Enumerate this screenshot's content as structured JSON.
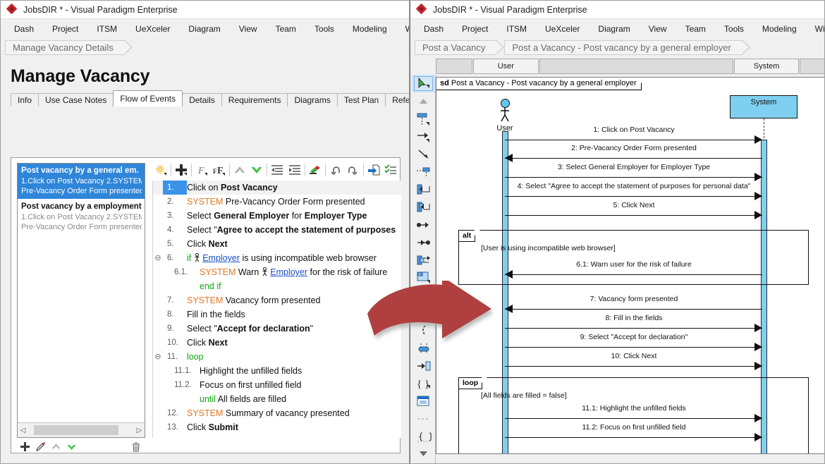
{
  "left_window": {
    "title": "JobsDIR * - Visual Paradigm Enterprise",
    "menu": [
      "Dash",
      "Project",
      "ITSM",
      "UeXceler",
      "Diagram",
      "View",
      "Team",
      "Tools",
      "Modeling",
      "Wi"
    ],
    "breadcrumb": [
      "Manage Vacancy Details"
    ],
    "page_title": "Manage Vacancy",
    "tabs": [
      {
        "label": "Info",
        "active": false
      },
      {
        "label": "Use Case Notes",
        "active": false
      },
      {
        "label": "Flow of Events",
        "active": true
      },
      {
        "label": "Details",
        "active": false
      },
      {
        "label": "Requirements",
        "active": false
      },
      {
        "label": "Diagrams",
        "active": false
      },
      {
        "label": "Test Plan",
        "active": false
      },
      {
        "label": "References",
        "active": false
      }
    ],
    "scenario_list": [
      {
        "title": "Post vacancy by a general em.",
        "sub1": "1.Click on Post Vacancy 2.SYSTEM",
        "sub2": "Pre-Vacancy Order Form presented...",
        "selected": true
      },
      {
        "title": "Post vacancy by a employment ager",
        "sub1": "1.Click on Post Vacancy 2.SYSTEM",
        "sub2": "Pre-Vacancy Order Form presented...",
        "selected": false
      }
    ],
    "list_toolbar_icons": [
      "add-icon",
      "pen-icon",
      "move-up-icon",
      "move-down-icon",
      "delete-icon"
    ],
    "editor_toolbar_icons": [
      "sparkle-icon",
      "add-icon",
      "italic-icon",
      "font-size-icon",
      "move-up-icon",
      "move-down-icon",
      "outdent-icon",
      "indent-icon",
      "highlight-icon",
      "undo-icon",
      "redo-icon",
      "insert-sub-icon",
      "checklist-icon"
    ],
    "flow_of_events": [
      {
        "num": "1.",
        "highlighted": true,
        "indent": 0,
        "parts": [
          {
            "t": "Click on ",
            "s": "n"
          },
          {
            "t": "Post Vacancy",
            "s": "b"
          }
        ]
      },
      {
        "num": "2.",
        "highlighted": false,
        "indent": 0,
        "parts": [
          {
            "t": "SYSTEM",
            "s": "sys"
          },
          {
            "t": "   Pre-Vacancy Order Form presented",
            "s": "n"
          }
        ]
      },
      {
        "num": "3.",
        "highlighted": false,
        "indent": 0,
        "parts": [
          {
            "t": "Select ",
            "s": "n"
          },
          {
            "t": "General Employer",
            "s": "b"
          },
          {
            "t": " for ",
            "s": "n"
          },
          {
            "t": "Employer Type",
            "s": "b"
          }
        ]
      },
      {
        "num": "4.",
        "highlighted": false,
        "indent": 0,
        "parts": [
          {
            "t": "Select \"",
            "s": "n"
          },
          {
            "t": "Agree to accept the statement of purposes",
            "s": "b"
          }
        ]
      },
      {
        "num": "5.",
        "highlighted": false,
        "indent": 0,
        "parts": [
          {
            "t": "Click ",
            "s": "n"
          },
          {
            "t": "Next",
            "s": "b"
          }
        ]
      },
      {
        "num": "6.",
        "highlighted": false,
        "indent": 0,
        "collapse": true,
        "parts": [
          {
            "t": "if",
            "s": "kw"
          },
          {
            "t": "    ",
            "s": "n"
          },
          {
            "t": "Employer",
            "s": "link"
          },
          {
            "t": " is using incompatible web browser",
            "s": "n"
          }
        ]
      },
      {
        "num": "6.1.",
        "highlighted": false,
        "indent": 1,
        "parts": [
          {
            "t": "SYSTEM",
            "s": "sys"
          },
          {
            "t": "   Warn ",
            "s": "n"
          },
          {
            "t": "Employer",
            "s": "link"
          },
          {
            "t": " for the risk of failure",
            "s": "n"
          }
        ]
      },
      {
        "num": "",
        "highlighted": false,
        "indent": 1,
        "parts": [
          {
            "t": "end if",
            "s": "kw"
          }
        ]
      },
      {
        "num": "7.",
        "highlighted": false,
        "indent": 0,
        "parts": [
          {
            "t": "SYSTEM",
            "s": "sys"
          },
          {
            "t": "   Vacancy form presented",
            "s": "n"
          }
        ]
      },
      {
        "num": "8.",
        "highlighted": false,
        "indent": 0,
        "parts": [
          {
            "t": "Fill in the fields",
            "s": "n"
          }
        ]
      },
      {
        "num": "9.",
        "highlighted": false,
        "indent": 0,
        "parts": [
          {
            "t": "Select \"",
            "s": "n"
          },
          {
            "t": "Accept for declaration",
            "s": "b"
          },
          {
            "t": "\"",
            "s": "n"
          }
        ]
      },
      {
        "num": "10.",
        "highlighted": false,
        "indent": 0,
        "parts": [
          {
            "t": "Click ",
            "s": "n"
          },
          {
            "t": "Next",
            "s": "b"
          }
        ]
      },
      {
        "num": "11.",
        "highlighted": false,
        "indent": 0,
        "collapse": true,
        "parts": [
          {
            "t": "loop",
            "s": "kw"
          }
        ]
      },
      {
        "num": "11.1.",
        "highlighted": false,
        "indent": 1,
        "parts": [
          {
            "t": "  Highlight the unfilled fields",
            "s": "n"
          }
        ]
      },
      {
        "num": "11.2.",
        "highlighted": false,
        "indent": 1,
        "parts": [
          {
            "t": "  Focus on first unfilled field",
            "s": "n"
          }
        ]
      },
      {
        "num": "",
        "highlighted": false,
        "indent": 1,
        "parts": [
          {
            "t": "until",
            "s": "kw"
          },
          {
            "t": "   All fields are filled",
            "s": "n"
          }
        ]
      },
      {
        "num": "12.",
        "highlighted": false,
        "indent": 0,
        "parts": [
          {
            "t": "SYSTEM",
            "s": "sys"
          },
          {
            "t": "   Summary of vacancy presented",
            "s": "n"
          }
        ]
      },
      {
        "num": "13.",
        "highlighted": false,
        "indent": 0,
        "parts": [
          {
            "t": "Click ",
            "s": "n"
          },
          {
            "t": "Submit",
            "s": "b"
          }
        ]
      }
    ]
  },
  "right_window": {
    "title": "JobsDIR * - Visual Paradigm Enterprise",
    "menu": [
      "Dash",
      "Project",
      "ITSM",
      "UeXceler",
      "Diagram",
      "View",
      "Team",
      "Tools",
      "Modeling",
      "Wind"
    ],
    "breadcrumb": [
      "Post a Vacancy",
      "Post a Vacancy - Post vacancy by a general employer"
    ],
    "column_headers": [
      "",
      "User",
      "",
      "System",
      ""
    ],
    "palette_icons": [
      "pointer-tool-icon",
      "scroll-up-icon",
      "lifeline-icon",
      "message-icon",
      "self-message-icon",
      "create-message-icon",
      "found-message-icon",
      "lost-message-icon",
      "call-message-icon",
      "return-message-icon",
      "recursive-message-icon",
      "frame-icon",
      "interaction-use-icon",
      "combined-fragment-icon",
      "duration-icon",
      "state-invariant-icon",
      "gate-icon",
      "constraint-icon",
      "note-icon",
      "divider-icon",
      "anchor-icon",
      "scroll-down-icon"
    ]
  },
  "chart_data": {
    "type": "sequence-diagram",
    "title": "sd Post a Vacancy - Post vacancy by a general employer",
    "frame_tag_keyword": "sd",
    "frame_tag_name": "Post a Vacancy - Post vacancy by a general employer",
    "lifelines": [
      {
        "name": "User",
        "kind": "actor"
      },
      {
        "name": "System",
        "kind": "object"
      }
    ],
    "messages": [
      {
        "seq": "1",
        "label": "1: Click on Post Vacancy",
        "from": "User",
        "to": "System",
        "dir": "right"
      },
      {
        "seq": "2",
        "label": "2: Pre-Vacancy Order Form presented",
        "from": "System",
        "to": "User",
        "dir": "left"
      },
      {
        "seq": "3",
        "label": "3: Select General Employer for Employer Type",
        "from": "User",
        "to": "System",
        "dir": "right"
      },
      {
        "seq": "4",
        "label": "4: Select \"Agree to accept the statement of purposes for personal data\"",
        "from": "User",
        "to": "System",
        "dir": "right"
      },
      {
        "seq": "5",
        "label": "5: Click Next",
        "from": "User",
        "to": "System",
        "dir": "right"
      },
      {
        "seq": "6.1",
        "label": "6.1: Warn user for the risk of failure",
        "from": "System",
        "to": "User",
        "dir": "left",
        "fragment": "alt"
      },
      {
        "seq": "7",
        "label": "7: Vacancy form presented",
        "from": "System",
        "to": "User",
        "dir": "left"
      },
      {
        "seq": "8",
        "label": "8: Fill in the fields",
        "from": "User",
        "to": "System",
        "dir": "right"
      },
      {
        "seq": "9",
        "label": "9: Select \"Accept for declaration\"",
        "from": "User",
        "to": "System",
        "dir": "right"
      },
      {
        "seq": "10",
        "label": "10: Click Next",
        "from": "User",
        "to": "System",
        "dir": "right"
      },
      {
        "seq": "11.1",
        "label": "11.1: Highlight the unfilled fields",
        "from": "User",
        "to": "System",
        "dir": "right",
        "fragment": "loop"
      },
      {
        "seq": "11.2",
        "label": "11.2: Focus on first unfilled field",
        "from": "User",
        "to": "System",
        "dir": "right",
        "fragment": "loop"
      }
    ],
    "fragments": [
      {
        "kind": "alt",
        "condition": "[User is using incompatible web browser]"
      },
      {
        "kind": "loop",
        "condition": "[All fields are filled = false]"
      }
    ],
    "colors": {
      "lifeline_fill": "#7fd0f0",
      "actor_head": "#66c6ef",
      "accent_red": "#b03a3a",
      "selection_blue": "#2f86d8"
    }
  }
}
